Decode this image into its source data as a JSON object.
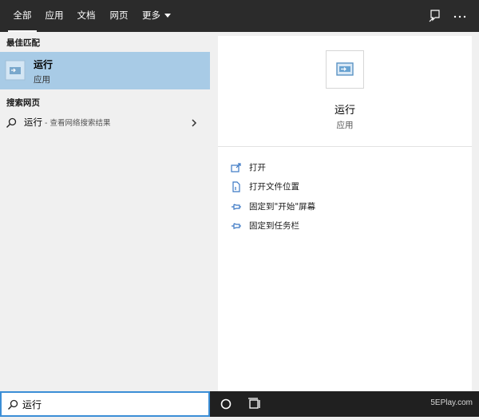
{
  "tabs": [
    {
      "label": "全部",
      "active": true
    },
    {
      "label": "应用"
    },
    {
      "label": "文档"
    },
    {
      "label": "网页"
    },
    {
      "label": "更多"
    }
  ],
  "top_icons": [
    "feedback-icon",
    "more-options-icon"
  ],
  "best_match": {
    "section_label": "最佳匹配",
    "title": "运行",
    "subtitle": "应用"
  },
  "web_search": {
    "section_label": "搜索网页",
    "query": "运行",
    "hint": " - 查看网络搜索结果"
  },
  "details": {
    "app_name": "运行",
    "app_type": "应用",
    "actions": [
      {
        "label": "打开",
        "icon": "open-icon"
      },
      {
        "label": "打开文件位置",
        "icon": "file-location-icon"
      },
      {
        "label": "固定到\"开始\"屏幕",
        "icon": "pin-icon"
      },
      {
        "label": "固定到任务栏",
        "icon": "pin-icon"
      }
    ]
  },
  "search": {
    "value": "运行"
  },
  "taskbar": {
    "icons": [
      "cortana-icon",
      "task-view-icon"
    ]
  },
  "watermark": "5EPlay.com",
  "colors": {
    "selected": "#a8cbe6",
    "accent": "#3b8ed6",
    "topbar": "#2b2b2b"
  }
}
